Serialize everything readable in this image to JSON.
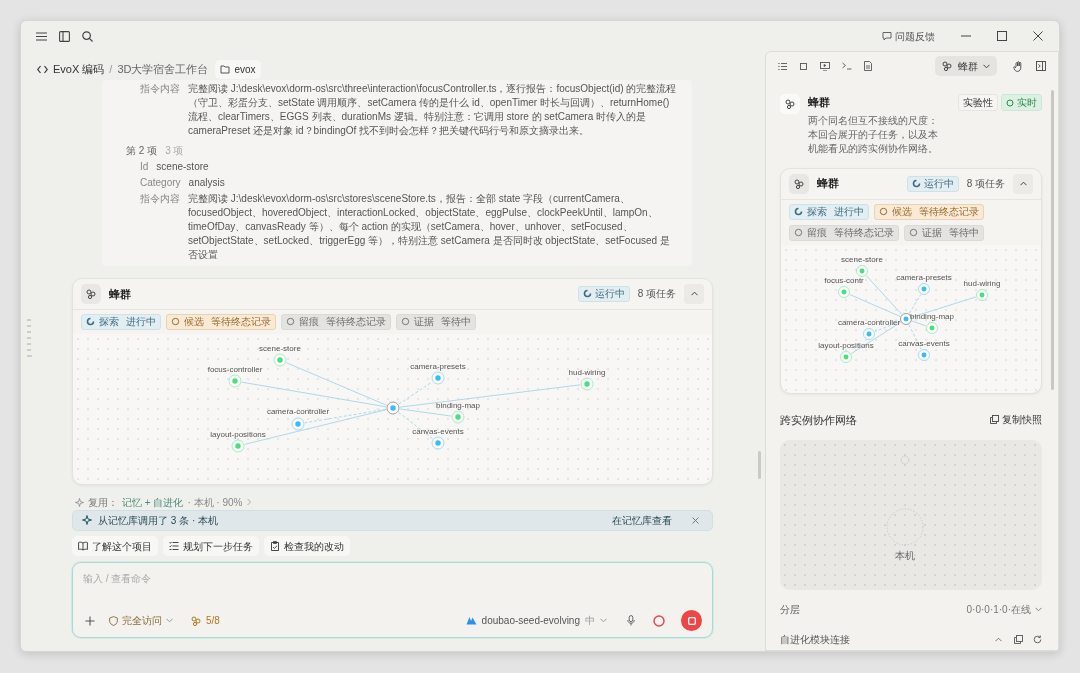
{
  "titlebar": {
    "feedback": "问题反馈"
  },
  "breadcrumb": {
    "project": "EvoX 编码",
    "separator": "/",
    "page": "3D大学宿舍工作台",
    "branch": "evox"
  },
  "task_detail": {
    "first_item_fields": [
      {
        "label": "指令内容",
        "value": "完整阅读 J:\\desk\\evox\\dorm-os\\src\\three\\interaction\\focusController.ts，逐行报告：focusObject(id) 的完整流程（守卫、彩蛋分支、setState 调用顺序、setCamera 传的是什么 id、openTimer 时长与回调）、returnHome() 流程、clearTimers、EGGS 列表、durationMs 逻辑。特别注意：它调用 store 的 setCamera 时传入的是 cameraPreset 还是对象 id？bindingOf 找不到时会怎样？把关键代码行号和原文摘录出来。"
      }
    ],
    "section": {
      "title": "第 2 项",
      "count": "3 项",
      "fields": [
        {
          "label": "Id",
          "value": "scene-store"
        },
        {
          "label": "Category",
          "value": "analysis"
        },
        {
          "label": "指令内容",
          "value": "完整阅读 J:\\desk\\evox\\dorm-os\\src\\stores\\sceneStore.ts，报告：全部 state 字段（currentCamera、focusedObject、hoveredObject、interactionLocked、objectState、eggPulse、clockPeekUntil、lampOn、timeOfDay、canvasReady 等）、每个 action 的实现（setCamera、hover、unhover、setFocused、setObjectState、setLocked、triggerEgg 等），特别注意 setCamera 是否同时改 objectState、setFocused 是否设置"
        }
      ]
    }
  },
  "swarm_card": {
    "title": "蜂群",
    "status": "运行中",
    "task_count": "8 项任务",
    "expanded": true,
    "tags": [
      {
        "kind": "active",
        "name": "探索",
        "state": "进行中"
      },
      {
        "kind": "candidate",
        "name": "候选",
        "state": "等待终态记录"
      },
      {
        "kind": "pending",
        "name": "留痕",
        "state": "等待终态记录"
      },
      {
        "kind": "pending",
        "name": "证据",
        "state": "等待中"
      }
    ],
    "nodes": [
      {
        "label": "scene-store",
        "color": "#4ade80",
        "kind": "solid"
      },
      {
        "label": "focus-controller",
        "color": "#4ade80",
        "kind": "solid"
      },
      {
        "label": "camera-presets",
        "color": "#38bdf8",
        "kind": "dashed"
      },
      {
        "label": "hud-wiring",
        "color": "#4ade80",
        "kind": "solid"
      },
      {
        "label": "camera-controller",
        "color": "#38bdf8",
        "kind": "dashed"
      },
      {
        "label": "binding-map",
        "color": "#4ade80",
        "kind": "solid"
      },
      {
        "label": "layout-positions",
        "color": "#4ade80",
        "kind": "solid"
      },
      {
        "label": "canvas-events",
        "color": "#38bdf8",
        "kind": "dashed"
      }
    ]
  },
  "reuse": {
    "label": "复用：",
    "sources": "记忆 + 自进化",
    "meta": "· 本机 · 90%"
  },
  "memory_banner": {
    "text": "从记忆库调用了 3 条 · 本机",
    "link": "在记忆库查看"
  },
  "quick_actions": [
    "了解这个项目",
    "规划下一步任务",
    "检查我的改动"
  ],
  "composer": {
    "placeholder": "输入 / 查看命令",
    "access": "完全访问",
    "agents": "5/8",
    "model": "doubao-seed-evolving",
    "effort": "中"
  },
  "side_panel": {
    "mode": "蜂群",
    "header": {
      "title": "蜂群",
      "description": "两个同名但互不接线的尺度：本回合展开的子任务，以及本机能看见的跨实例协作网络。",
      "badges": [
        {
          "kind": "plain",
          "label": "实验性"
        },
        {
          "kind": "live",
          "label": "实时"
        }
      ]
    },
    "swarm_card": {
      "title": "蜂群",
      "status": "运行中",
      "task_count": "8 项任务",
      "expanded": true,
      "tags": [
        {
          "kind": "active",
          "name": "探索",
          "state": "进行中"
        },
        {
          "kind": "candidate",
          "name": "候选",
          "state": "等待终态记录"
        },
        {
          "kind": "pending",
          "name": "留痕",
          "state": "等待终态记录"
        },
        {
          "kind": "pending",
          "name": "证据",
          "state": "等待中"
        }
      ],
      "nodes": [
        {
          "label": "scene-store",
          "color": "#4ade80",
          "kind": "solid"
        },
        {
          "label": "focus-contr",
          "color": "#4ade80",
          "kind": "solid"
        },
        {
          "label": "camera-presets",
          "color": "#38bdf8",
          "kind": "dashed"
        },
        {
          "label": "hud-wiring",
          "color": "#4ade80",
          "kind": "solid"
        },
        {
          "label": "camera-controller",
          "color": "#38bdf8",
          "kind": "dashed"
        },
        {
          "label": "binding-map",
          "color": "#4ade80",
          "kind": "solid"
        },
        {
          "label": "layout-positions",
          "color": "#4ade80",
          "kind": "solid"
        },
        {
          "label": "canvas-events",
          "color": "#38bdf8",
          "kind": "dashed"
        }
      ]
    },
    "network": {
      "title": "跨实例协作网络",
      "copy": "复制快照",
      "node_label": "本机"
    },
    "layers": {
      "label": "分层",
      "value": "0·0·0·1·0·在线"
    },
    "modules": {
      "title": "自进化模块连接"
    }
  }
}
